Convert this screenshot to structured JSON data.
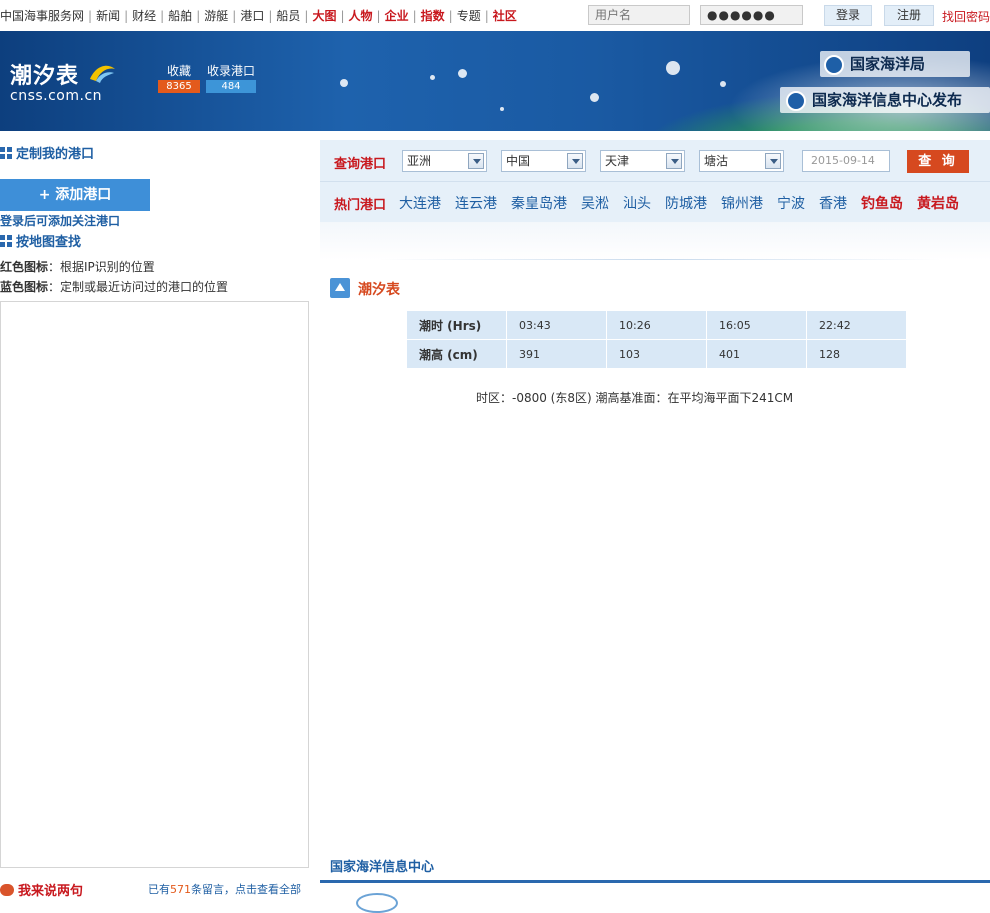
{
  "nav": {
    "items": [
      {
        "label": "中国海事服务网",
        "hot": false
      },
      {
        "label": "新闻",
        "hot": false
      },
      {
        "label": "财经",
        "hot": false
      },
      {
        "label": "船舶",
        "hot": false
      },
      {
        "label": "游艇",
        "hot": false
      },
      {
        "label": "港口",
        "hot": false
      },
      {
        "label": "船员",
        "hot": false
      },
      {
        "label": "大图",
        "hot": true
      },
      {
        "label": "人物",
        "hot": true
      },
      {
        "label": "企业",
        "hot": true
      },
      {
        "label": "指数",
        "hot": true
      },
      {
        "label": "专题",
        "hot": false
      },
      {
        "label": "社区",
        "hot": true
      }
    ]
  },
  "login": {
    "username_placeholder": "用户名",
    "password_mask": "●●●●●●",
    "login_label": "登录",
    "register_label": "注册",
    "forgot_label": "找回密码"
  },
  "banner": {
    "title": "潮汐表",
    "domain": "cnss.com.cn",
    "fav_label": "收藏",
    "fav_count": "8365",
    "ports_label": "收录港口",
    "ports_count": "484",
    "org1": "国家海洋局",
    "org2": "国家海洋信息中心发布"
  },
  "sidebar": {
    "my_ports_title": "定制我的港口",
    "add_port_label": "+ 添加港口",
    "add_hint": "登录后可添加关注港口",
    "map_title": "按地图查找",
    "red_label": "红色图标",
    "red_text": "：根据IP识别的位置",
    "blue_label": "蓝色图标",
    "blue_text": "：定制或最近访问过的港口的位置",
    "comment_title": "我来说两句",
    "comment_prefix": "已有",
    "comment_count": "571",
    "comment_suffix": "条留言，点击查看全部"
  },
  "query": {
    "label": "查询港口",
    "continent": "亚洲",
    "country": "中国",
    "city": "天津",
    "port": "塘沽",
    "date_placeholder": "2015-09-14",
    "button_label": "查 询",
    "hot_label": "热门港口",
    "hot_ports": [
      {
        "name": "大连港",
        "special": false
      },
      {
        "name": "连云港",
        "special": false
      },
      {
        "name": "秦皇岛港",
        "special": false
      },
      {
        "name": "吴淞",
        "special": false
      },
      {
        "name": "汕头",
        "special": false
      },
      {
        "name": "防城港",
        "special": false
      },
      {
        "name": "锦州港",
        "special": false
      },
      {
        "name": "宁波",
        "special": false
      },
      {
        "name": "香港",
        "special": false
      },
      {
        "name": "钓鱼岛",
        "special": true
      },
      {
        "name": "黄岩岛",
        "special": true
      }
    ]
  },
  "tide": {
    "title": "潮汐表",
    "time_header": "潮时 (Hrs)",
    "height_header": "潮高 (cm)",
    "times": [
      "03:43",
      "10:26",
      "16:05",
      "22:42"
    ],
    "heights": [
      "391",
      "103",
      "401",
      "128"
    ],
    "timezone_note": "时区：-0800 (东8区) 潮高基准面：在平均海平面下241CM"
  },
  "footer": {
    "title": "国家海洋信息中心"
  },
  "colors": {
    "accent_red": "#c8181e",
    "accent_blue": "#1f5fa3",
    "query_button": "#d6491f",
    "table_cell": "#d9e8f6"
  }
}
